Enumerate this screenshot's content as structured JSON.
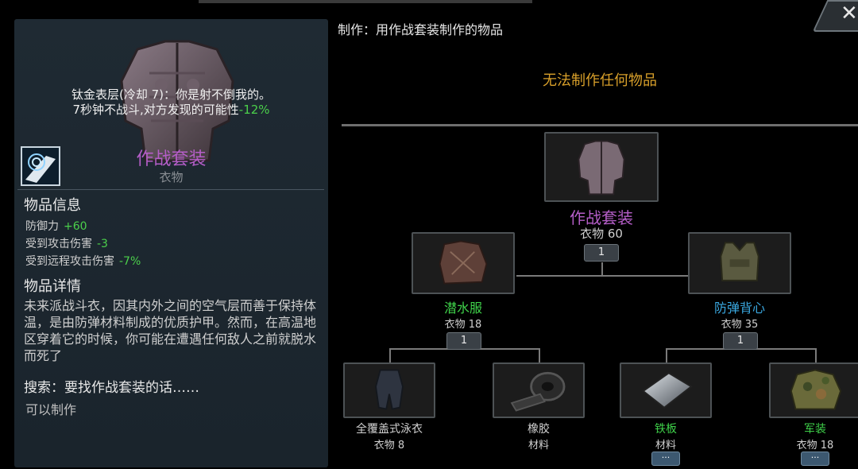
{
  "left": {
    "skill_line1": "钛金表层(冷却 7)：你是射不倒我的。",
    "skill_line2_prefix": "7秒钟不战斗,对方发现的可能性",
    "skill_line2_value": "-12%",
    "item_name": "作战套装",
    "item_type": "衣物",
    "info_title": "物品信息",
    "stats": [
      {
        "label": "防御力",
        "value": "+60"
      },
      {
        "label": "受到攻击伤害",
        "value": "-3"
      },
      {
        "label": "受到远程攻击伤害",
        "value": "-7%"
      }
    ],
    "details_title": "物品详情",
    "description": "未来派战斗衣，因其内外之间的空气层而善于保持体温，是由防弹材料制成的优质护甲。然而，在高温地区穿着它的时候，你可能在遭遇任何敌人之前就脱水而死了",
    "search_text": "搜索：要找作战套装的话……",
    "can_craft": "可以制作"
  },
  "right": {
    "header": "制作：用作战套装制作的物品",
    "cannot_craft": "无法制作任何物品",
    "root": {
      "name": "作战套装",
      "sub": "衣物 60",
      "count": "1"
    },
    "children": [
      {
        "name": "潜水服",
        "sub": "衣物 18",
        "count": "1"
      },
      {
        "name": "防弹背心",
        "sub": "衣物 35",
        "count": "1"
      }
    ],
    "grandchildren": [
      {
        "name": "全覆盖式泳衣",
        "sub": "衣物 8"
      },
      {
        "name": "橡胶",
        "sub": "材料"
      },
      {
        "name": "铁板",
        "sub": "材料",
        "more": "···"
      },
      {
        "name": "军装",
        "sub": "衣物 18",
        "more": "···"
      }
    ]
  },
  "colors": {
    "epic": "#b55ec8",
    "uncommon": "#3fd24a",
    "rare": "#3aa8e0",
    "common": "#d0d0d0",
    "warning": "#d9a02a"
  },
  "close_label": "✕"
}
